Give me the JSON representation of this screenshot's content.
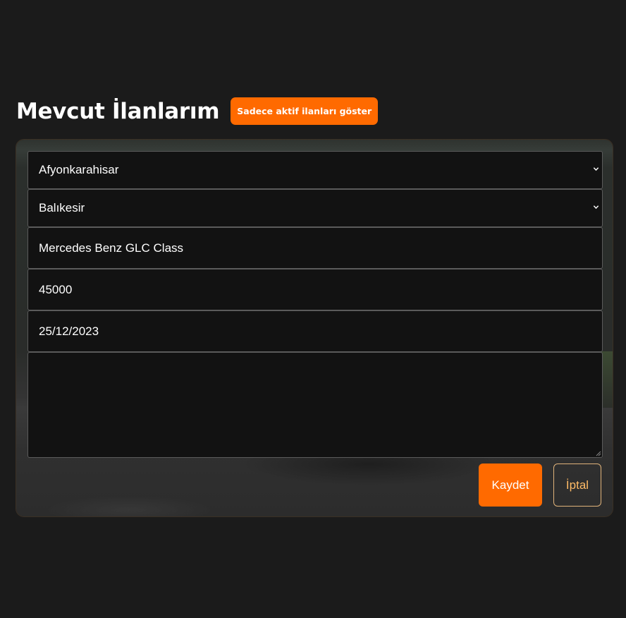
{
  "header": {
    "title": "Mevcut İlanlarım",
    "filter_button_label": "Sadece aktif ilanları göster"
  },
  "form": {
    "from_city": {
      "selected": "Afyonkarahisar",
      "icon": "chevron-down-icon"
    },
    "to_city": {
      "selected": "Balıkesir",
      "icon": "chevron-down-icon"
    },
    "vehicle": {
      "value": "Mercedes Benz GLC Class"
    },
    "price": {
      "value": "45000"
    },
    "date": {
      "value": "25/12/2023"
    },
    "description": {
      "value": ""
    }
  },
  "actions": {
    "save_label": "Kaydet",
    "cancel_label": "İptal"
  },
  "colors": {
    "accent": "#ff6a00",
    "background": "#1b1b1b",
    "field_background": "#121212",
    "cancel_text": "#ffbb66"
  }
}
